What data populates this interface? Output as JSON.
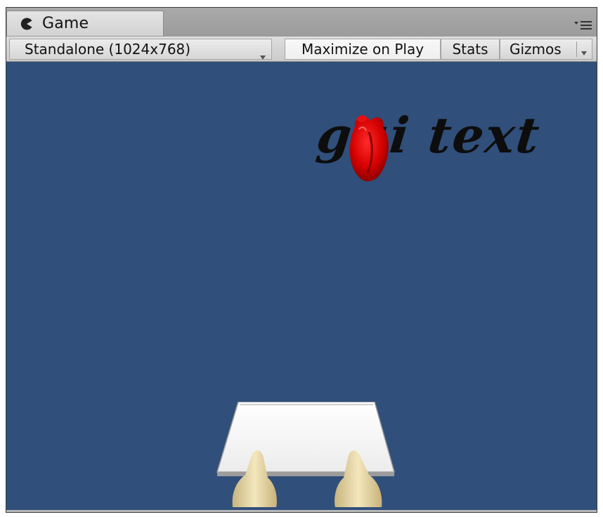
{
  "tab": {
    "label": "Game",
    "icon": "pacman-icon"
  },
  "toolbar": {
    "aspect_label": "Standalone (1024x768)",
    "maximize_label": "Maximize on Play",
    "stats_label": "Stats",
    "gizmos_label": "Gizmos"
  },
  "viewport": {
    "background_color": "#304f7b",
    "gui_text": "gui text"
  },
  "icons": [
    "pacman-icon",
    "pane-menu-icon",
    "dropdown-arrow-icon",
    "heart-icon"
  ]
}
